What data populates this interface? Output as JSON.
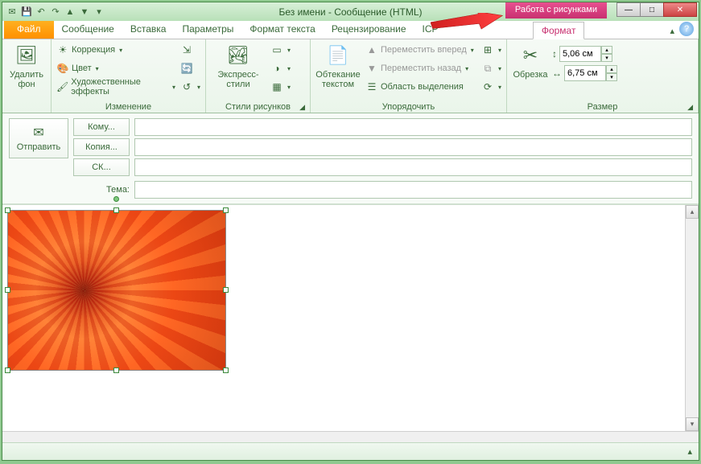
{
  "title": "Без имени  -  Сообщение (HTML)",
  "contextual_tab": "Работа с рисунками",
  "tabs": {
    "file": "Файл",
    "message": "Сообщение",
    "insert": "Вставка",
    "options": "Параметры",
    "format_text": "Формат текста",
    "review": "Рецензирование",
    "icp": "ICP",
    "format": "Формат"
  },
  "ribbon": {
    "remove_bg": "Удалить фон",
    "corrections": "Коррекция",
    "color": "Цвет",
    "artistic": "Художественные эффекты",
    "group_change": "Изменение",
    "express_styles": "Экспресс-стили",
    "group_styles": "Стили рисунков",
    "wrap_text": "Обтекание текстом",
    "bring_forward": "Переместить вперед",
    "send_backward": "Переместить назад",
    "selection_pane": "Область выделения",
    "group_arrange": "Упорядочить",
    "crop": "Обрезка",
    "height_val": "5,06 см",
    "width_val": "6,75 см",
    "group_size": "Размер"
  },
  "compose": {
    "send": "Отправить",
    "to": "Кому...",
    "cc": "Копия...",
    "bcc": "СК...",
    "subject_label": "Тема:"
  }
}
